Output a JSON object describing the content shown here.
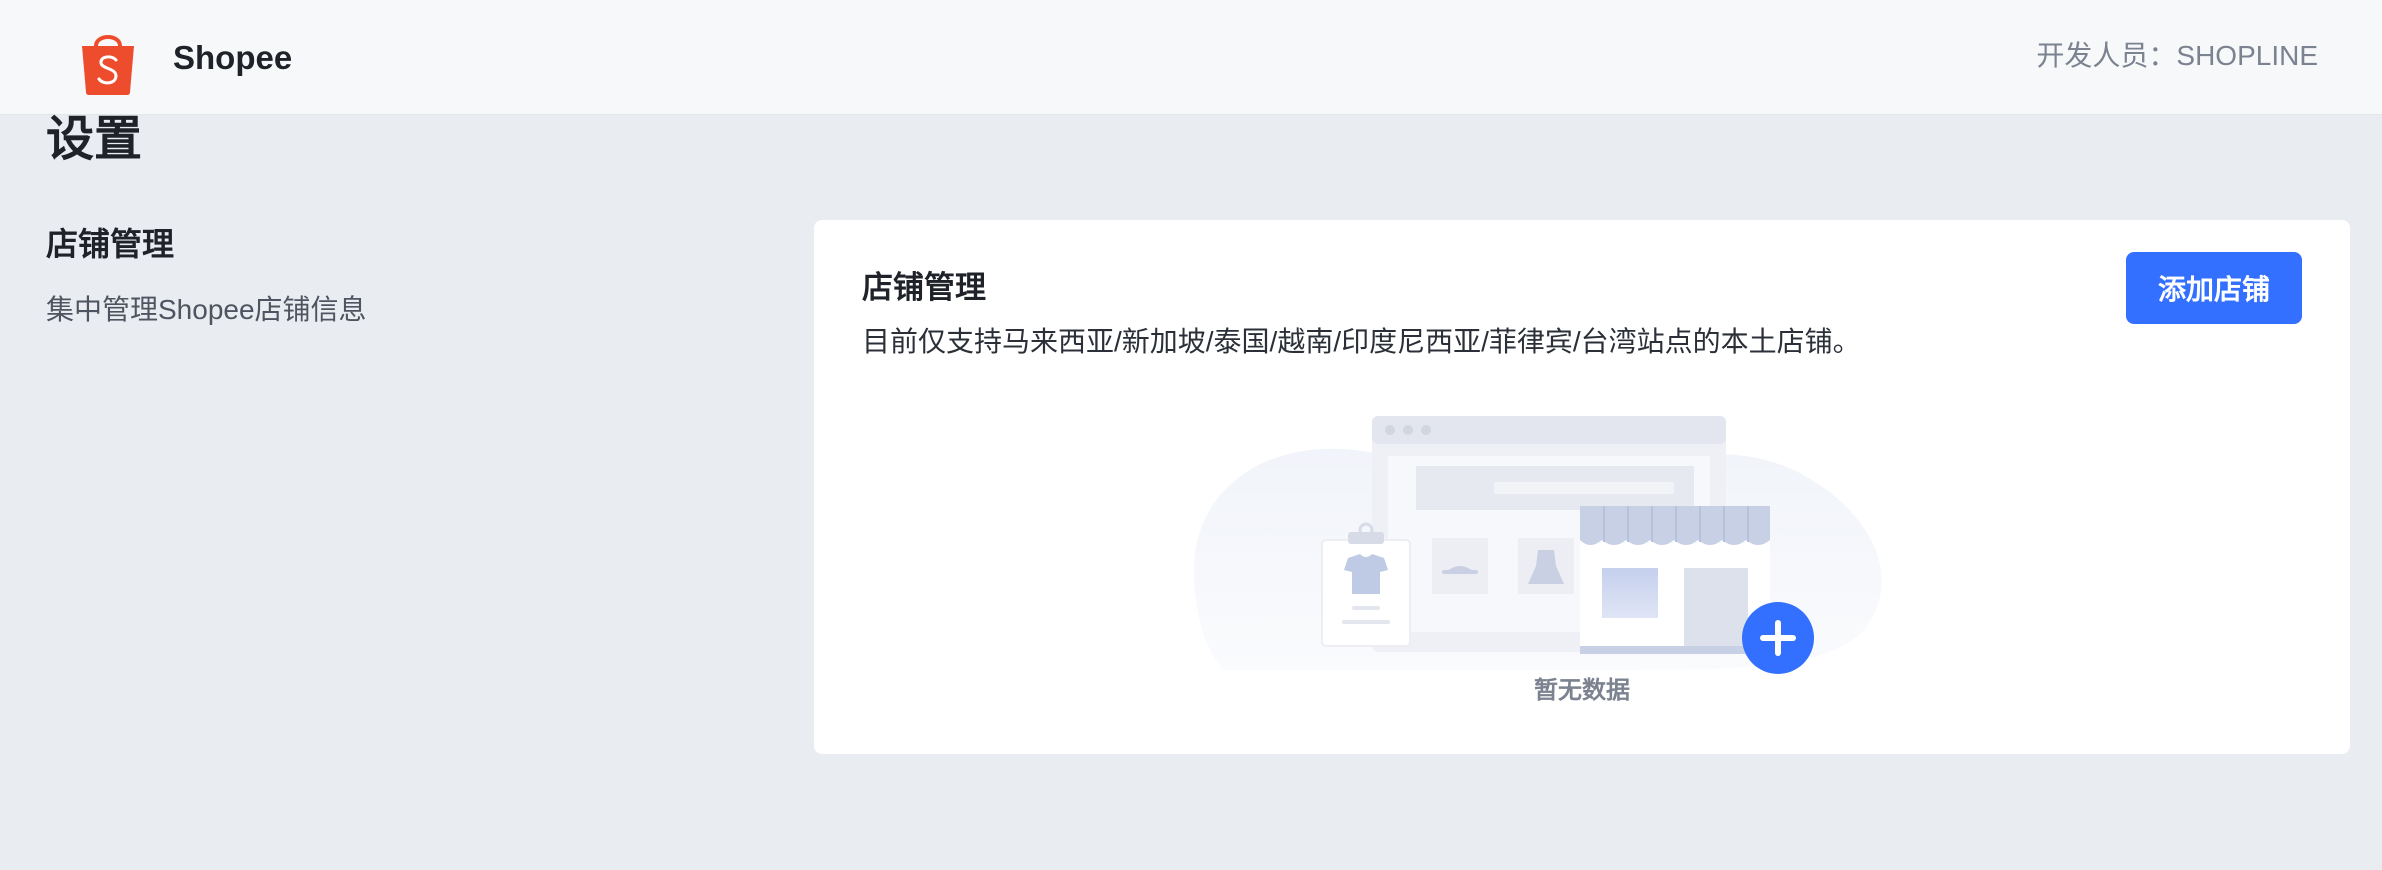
{
  "header": {
    "brand": "Shopee",
    "developer": "开发人员：SHOPLINE",
    "logo_icon": "shopee-bag-icon",
    "brand_color": "#ee4d2d"
  },
  "page": {
    "title": "设置"
  },
  "section": {
    "title": "店铺管理",
    "description": "集中管理Shopee店铺信息"
  },
  "card": {
    "title": "店铺管理",
    "description": "目前仅支持马来西亚/新加坡/泰国/越南/印度尼西亚/菲律宾/台湾站点的本土店铺。",
    "add_button_label": "添加店铺",
    "accent_color": "#3370ff",
    "empty_text": "暂无数据",
    "empty_icon": "empty-store-illustration"
  }
}
